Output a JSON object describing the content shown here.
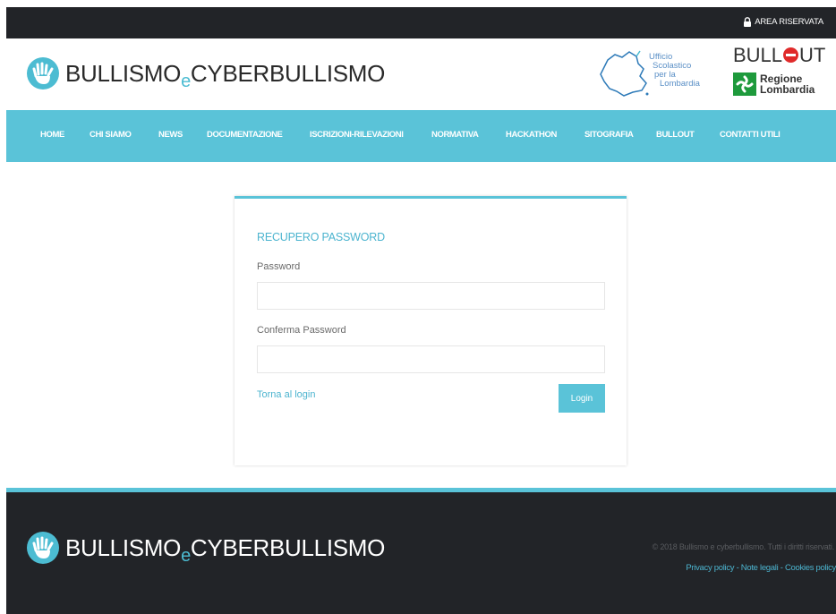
{
  "topbar": {
    "area_label": "AREA RISERVATA"
  },
  "header": {
    "logo_part1": "BULLISMO",
    "logo_e": "e",
    "logo_part2": "CYBERBULLISMO",
    "usr_line1": "Ufficio",
    "usr_line2": "Scolastico",
    "usr_line3": "per la",
    "usr_line4": "Lombardia",
    "bullout_left": "BULL",
    "bullout_right": "UT",
    "regione_line1": "Regione",
    "regione_line2": "Lombardia"
  },
  "nav": {
    "items": [
      {
        "label": "HOME"
      },
      {
        "label": "CHI SIAMO"
      },
      {
        "label": "NEWS"
      },
      {
        "label": "DOCUMENTAZIONE"
      },
      {
        "label": "ISCRIZIONI-RILEVAZIONI"
      },
      {
        "label": "NORMATIVA"
      },
      {
        "label": "HACKATHON"
      },
      {
        "label": "SITOGRAFIA"
      },
      {
        "label": "BULLOUT"
      },
      {
        "label": "CONTATTI UTILI"
      }
    ]
  },
  "form": {
    "title": "RECUPERO PASSWORD",
    "password_label": "Password",
    "password_value": "",
    "confirm_label": "Conferma Password",
    "confirm_value": "",
    "back_link": "Torna al login",
    "login_button": "Login"
  },
  "footer": {
    "copyright": "© 2018 Bullismo e cyberbullismo. Tutti i diritti riservati.",
    "privacy": "Privacy policy",
    "note": "Note legali",
    "cookies": "Cookies policy",
    "separator": " - "
  },
  "colors": {
    "accent": "#5ac3d8",
    "dark": "#222428",
    "link": "#4cb4cf"
  },
  "icons": [
    "lock-icon",
    "hand-logo-icon",
    "lombardia-map-icon",
    "regione-logo-icon"
  ]
}
